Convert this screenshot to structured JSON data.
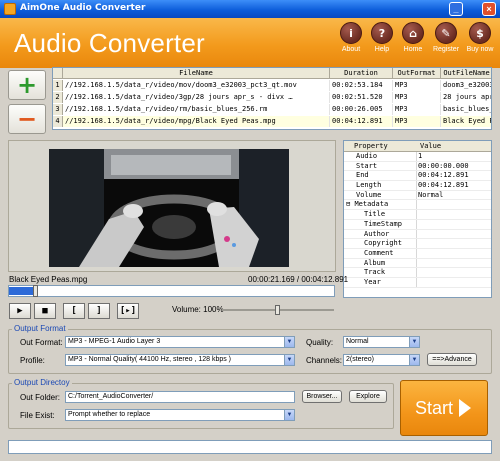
{
  "window": {
    "title": "AimOne Audio Converter"
  },
  "header": {
    "brand": "Audio Converter",
    "buttons": [
      {
        "label": "About",
        "icon": "info-icon"
      },
      {
        "label": "Help",
        "icon": "help-icon"
      },
      {
        "label": "Home",
        "icon": "home-icon"
      },
      {
        "label": "Register",
        "icon": "register-icon"
      },
      {
        "label": "Buy now",
        "icon": "cart-icon"
      }
    ]
  },
  "files": {
    "columns": [
      "FileName",
      "Duration",
      "OutFormat",
      "OutFileName"
    ],
    "rows": [
      {
        "index": "1",
        "filename": "//192.168.1.5/data_r/video/mov/doom3_e32003_pct3_qt.mov",
        "duration": "00:02:53.184",
        "format": "MP3",
        "outname": "doom3_e32003_pct3_qt"
      },
      {
        "index": "2",
        "filename": "//192.168.1.5/data_r/video/3gp/28 jours apr_s - divx …",
        "duration": "00:02:51.520",
        "format": "MP3",
        "outname": "28 jours apr_s - div…"
      },
      {
        "index": "3",
        "filename": "//192.168.1.5/data_r/video/rm/basic_blues_256.rm",
        "duration": "00:00:26.005",
        "format": "MP3",
        "outname": "basic_blues_256"
      },
      {
        "index": "4",
        "filename": "//192.168.1.5/data_r/video/mpg/Black Eyed Peas.mpg",
        "duration": "00:04:12.891",
        "format": "MP3",
        "outname": "Black Eyed Peas"
      }
    ]
  },
  "properties": {
    "header_key": "Property",
    "header_value": "Value",
    "rows": [
      {
        "key": "Audio",
        "value": "1",
        "indent": 1
      },
      {
        "key": "Start",
        "value": "00:00:00.000",
        "indent": 1
      },
      {
        "key": "End",
        "value": "00:04:12.891",
        "indent": 1
      },
      {
        "key": "Length",
        "value": "00:04:12.891",
        "indent": 1
      },
      {
        "key": "Volume",
        "value": "Normal",
        "indent": 1
      },
      {
        "key": "Metadata",
        "value": "",
        "indent": 0
      },
      {
        "key": "Title",
        "value": "",
        "indent": 2
      },
      {
        "key": "TimeStamp",
        "value": "",
        "indent": 2
      },
      {
        "key": "Author",
        "value": "",
        "indent": 2
      },
      {
        "key": "Copyright",
        "value": "",
        "indent": 2
      },
      {
        "key": "Comment",
        "value": "",
        "indent": 2
      },
      {
        "key": "Album",
        "value": "",
        "indent": 2
      },
      {
        "key": "Track",
        "value": "",
        "indent": 2
      },
      {
        "key": "Year",
        "value": "",
        "indent": 2
      }
    ]
  },
  "player": {
    "current_file": "Black Eyed Peas.mpg",
    "time": "00:00:21.169 / 00:04:12.891",
    "progress_fraction": 0.083,
    "volume_label": "Volume: 100%",
    "volume_fraction": 0.5,
    "controls": [
      {
        "name": "play-button",
        "glyph": "▶"
      },
      {
        "name": "stop-button",
        "glyph": "■"
      },
      {
        "name": "mark-start-button",
        "glyph": "["
      },
      {
        "name": "mark-end-button",
        "glyph": "]"
      },
      {
        "name": "clip-button",
        "glyph": "[▸]"
      }
    ]
  },
  "output_format": {
    "group_title": "Output Format",
    "out_format_label": "Out Format:",
    "out_format_value": "MP3 - MPEG-1 Audio Layer 3",
    "quality_label": "Quality:",
    "quality_value": "Normal",
    "profile_label": "Profile:",
    "profile_value": "MP3 - Normal Quality( 44100 Hz, stereo , 128 kbps )",
    "channels_label": "Channels:",
    "channels_value": "2(stereo)",
    "advance_label": "==>Advance"
  },
  "output_directory": {
    "group_title": "Output Directoy",
    "folder_label": "Out Folder:",
    "folder_value": "C:/Torrent_AudioConverter/",
    "browse_label": "Browser...",
    "explore_label": "Explore",
    "file_exist_label": "File Exist:",
    "file_exist_value": "Prompt whether to replace"
  },
  "start": {
    "label": "Start"
  },
  "colors": {
    "accent_orange": "#f39a1c",
    "brand_white": "#ffffff",
    "group_title": "#1a48b4"
  }
}
